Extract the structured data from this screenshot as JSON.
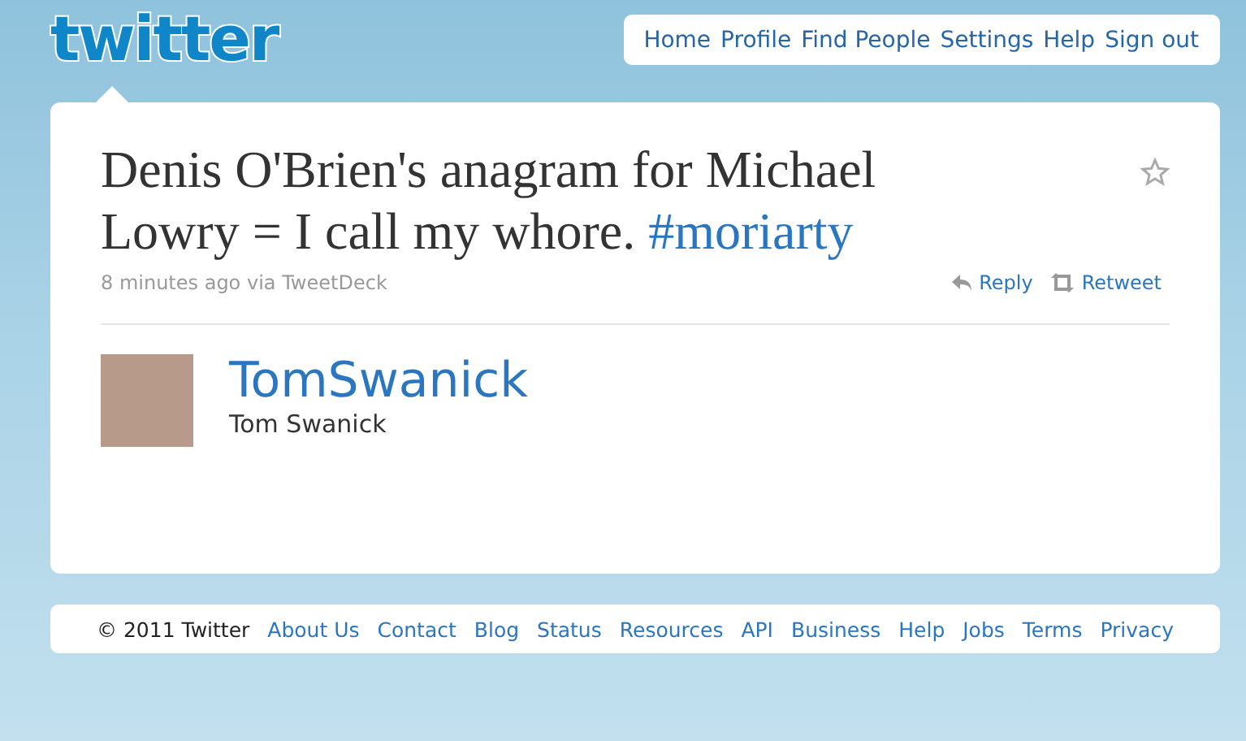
{
  "header": {
    "logo": "twitter",
    "nav": [
      "Home",
      "Profile",
      "Find People",
      "Settings",
      "Help",
      "Sign out"
    ]
  },
  "tweet": {
    "text": "Denis O'Brien's anagram for Michael Lowry = I call my whore.",
    "hashtag": "#moriarty",
    "favorited": false,
    "time": "8 minutes ago",
    "via": "via TweetDeck",
    "actions": [
      {
        "kind": "reply",
        "label": "Reply"
      },
      {
        "kind": "retweet",
        "label": "Retweet"
      }
    ]
  },
  "author": {
    "screen_name": "TomSwanick",
    "full_name": "Tom Swanick"
  },
  "footer": {
    "copyright": "© 2011 Twitter",
    "links": [
      "About Us",
      "Contact",
      "Blog",
      "Status",
      "Resources",
      "API",
      "Business",
      "Help",
      "Jobs",
      "Terms",
      "Privacy"
    ]
  }
}
